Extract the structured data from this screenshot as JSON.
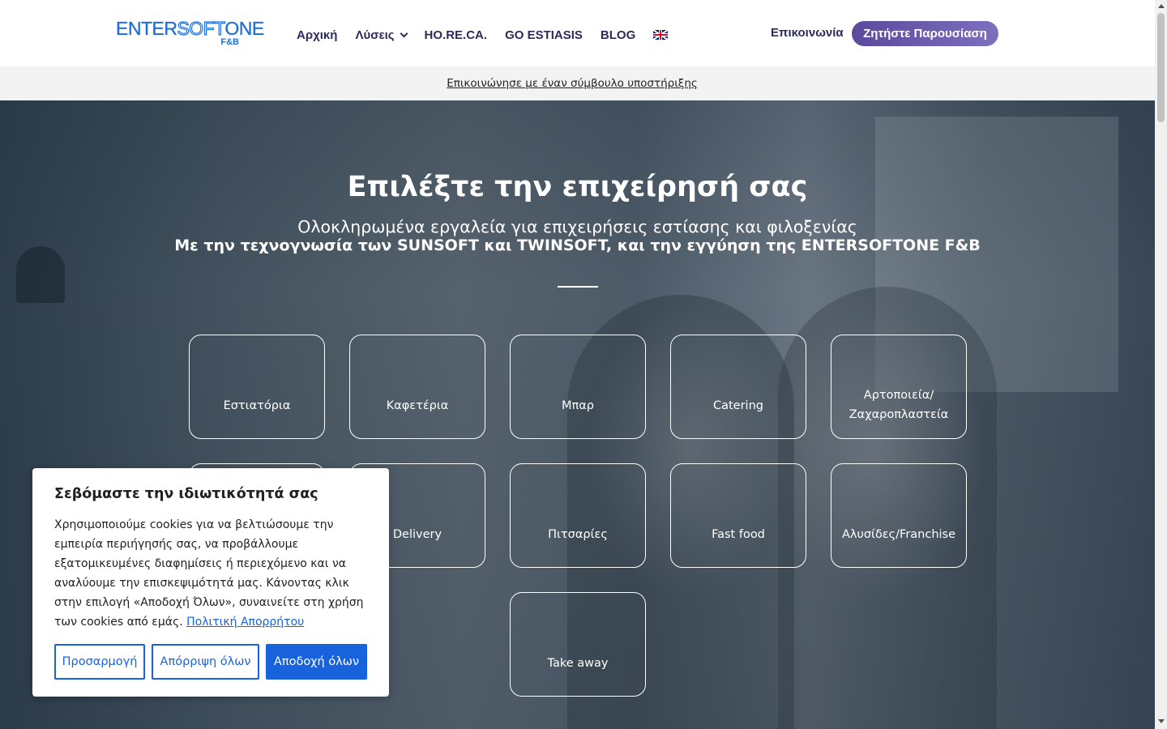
{
  "header": {
    "logo": {
      "main_a": "ENTER",
      "main_b": "SOFT",
      "main_c": "ONE",
      "sub": "F&B"
    },
    "nav": [
      {
        "label": "Αρχική"
      },
      {
        "label": "Λύσεις",
        "has_dropdown": true
      },
      {
        "label": "HO.RE.CA."
      },
      {
        "label": "GO ESTIASIS"
      },
      {
        "label": "BLOG"
      }
    ],
    "language_icon": "uk-flag-icon",
    "contact_label": "Επικοινωνία",
    "cta_label": "Ζητήστε Παρουσίαση"
  },
  "support_bar": {
    "link_label": "Επικοινώνησε με έναν σύμβουλο υποστήριξης"
  },
  "hero": {
    "title": "Επιλέξτε την επιχείρησή σας",
    "subtitle": "Ολοκληρωμένα εργαλεία για επιχειρήσεις εστίασης και φιλοξενίας",
    "subtitle_bold": "Με την τεχνογνωσία των SUNSOFT και TWINSOFT, και την εγγύηση της ENTERSOFTONE F&B",
    "cards": [
      {
        "label": "Εστιατόρια"
      },
      {
        "label": "Καφετέρια"
      },
      {
        "label": "Μπαρ"
      },
      {
        "label": "Catering"
      },
      {
        "label": "Αρτοποιεία/ Ζαχαροπλαστεία"
      },
      {
        "label": ""
      },
      {
        "label": "Delivery"
      },
      {
        "label": "Πιτσαρίες"
      },
      {
        "label": "Fast food"
      },
      {
        "label": "Αλυσίδες/Franchise"
      },
      {
        "label": "Take away"
      }
    ]
  },
  "cookie_dialog": {
    "title": "Σεβόμαστε την ιδιωτικότητά σας",
    "text": "Χρησιμοποιούμε cookies για να βελτιώσουμε την εμπειρία περιήγησής σας, να προβάλλουμε εξατομικευμένες διαφημίσεις ή περιεχόμενο και να αναλύουμε την επισκεψιμότητά μας. Κάνοντας κλικ στην επιλογή «Αποδοχή Όλων», συναινείτε στη χρήση των cookies από εμάς.",
    "policy_link": "Πολιτική Απορρήτου",
    "buttons": {
      "customize": "Προσαρμογή",
      "reject": "Απόρριψη όλων",
      "accept": "Αποδοχή όλων"
    }
  },
  "colors": {
    "brand_blue": "#1f6fd6",
    "nav_text": "#2b2b5a",
    "cta_purple": "#6a5aad",
    "cookie_blue": "#1863dc"
  }
}
